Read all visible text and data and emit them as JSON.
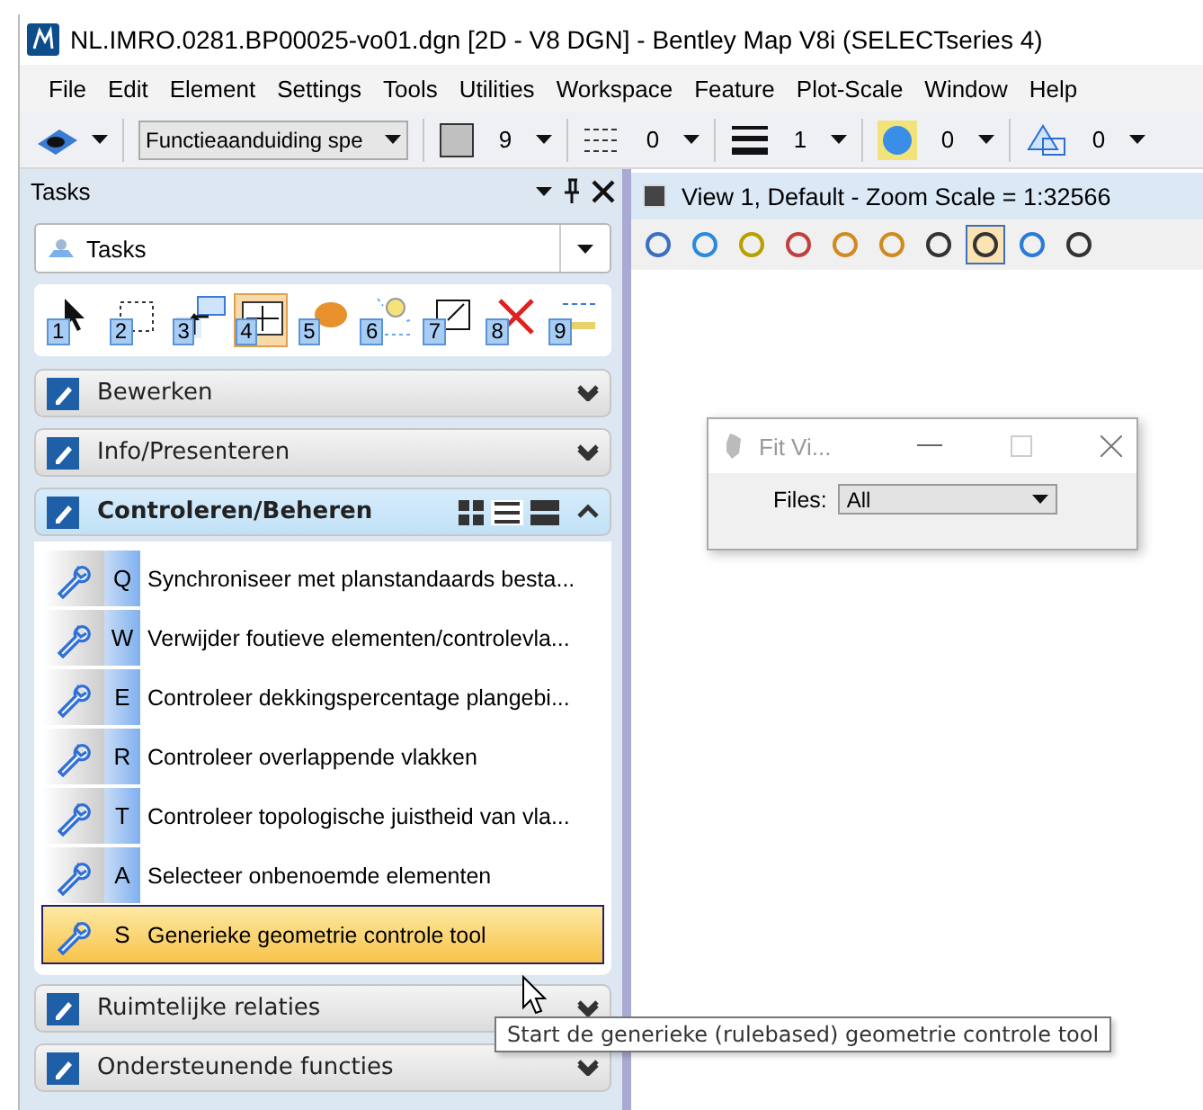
{
  "window": {
    "title": "NL.IMRO.0281.BP00025-vo01.dgn [2D - V8 DGN] - Bentley Map V8i (SELECTseries 4)"
  },
  "menu": [
    "File",
    "Edit",
    "Element",
    "Settings",
    "Tools",
    "Utilities",
    "Workspace",
    "Feature",
    "Plot-Scale",
    "Window",
    "Help"
  ],
  "toolbar": {
    "level": "Functieaanduiding spe",
    "color_number": "9",
    "style": "0",
    "weight": "1",
    "transparency": "0",
    "priority": "0"
  },
  "tasks_pane": {
    "title": "Tasks",
    "dropdown": "Tasks",
    "tool_icons": [
      {
        "number": "1",
        "selected": false
      },
      {
        "number": "2",
        "selected": false
      },
      {
        "number": "3",
        "selected": false
      },
      {
        "number": "4",
        "selected": true
      },
      {
        "number": "5",
        "selected": false
      },
      {
        "number": "6",
        "selected": false
      },
      {
        "number": "7",
        "selected": false
      },
      {
        "number": "8",
        "selected": false
      },
      {
        "number": "9",
        "selected": false
      }
    ],
    "sections": [
      {
        "label": "Bewerken",
        "expanded": false
      },
      {
        "label": "Info/Presenteren",
        "expanded": false
      },
      {
        "label": "Controleren/Beheren",
        "expanded": true,
        "tools": [
          {
            "key": "Q",
            "label": "Synchroniseer met planstandaards besta...",
            "selected": false
          },
          {
            "key": "W",
            "label": "Verwijder foutieve elementen/controlevla...",
            "selected": false
          },
          {
            "key": "E",
            "label": "Controleer dekkingspercentage plangebi...",
            "selected": false
          },
          {
            "key": "R",
            "label": "Controleer overlappende vlakken",
            "selected": false
          },
          {
            "key": "T",
            "label": "Controleer topologische juistheid van vla...",
            "selected": false
          },
          {
            "key": "A",
            "label": "Selecteer onbenoemde elementen",
            "selected": false
          },
          {
            "key": "S",
            "label": "Generieke geometrie controle tool",
            "selected": true
          }
        ]
      },
      {
        "label": "Ruimtelijke relaties",
        "expanded": false
      },
      {
        "label": "Ondersteunende functies",
        "expanded": false
      }
    ]
  },
  "view": {
    "title": "View 1, Default - Zoom Scale = 1:32566",
    "tools": [
      {
        "selected": false
      },
      {
        "selected": false
      },
      {
        "selected": false
      },
      {
        "selected": false
      },
      {
        "selected": false
      },
      {
        "selected": false
      },
      {
        "selected": false
      },
      {
        "selected": true
      },
      {
        "selected": false
      },
      {
        "selected": false
      }
    ]
  },
  "fit_view_dialog": {
    "title": "Fit Vi...",
    "files_label": "Files:",
    "files_value": "All"
  },
  "tooltip": "Start de generieke (rulebased) geometrie controle tool"
}
